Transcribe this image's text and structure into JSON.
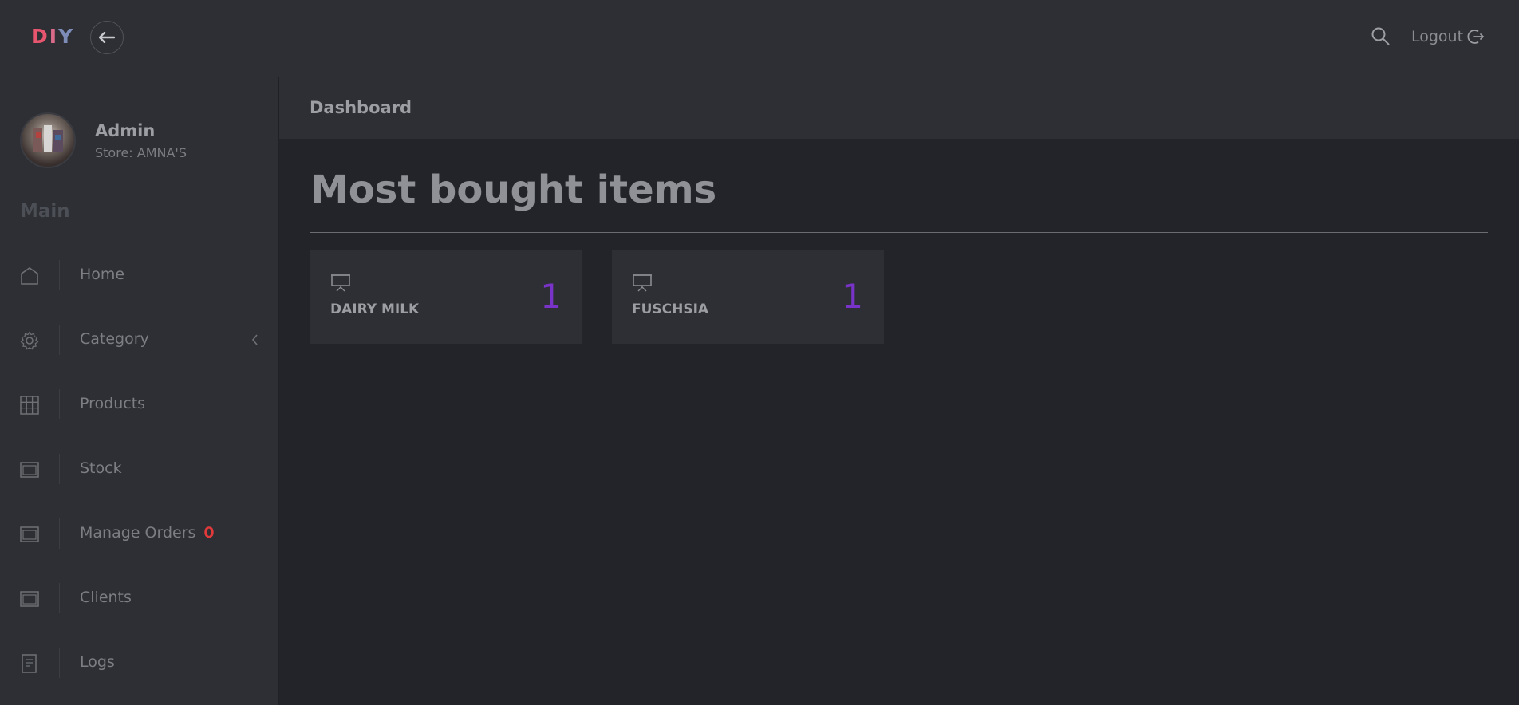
{
  "header": {
    "logo": {
      "l1": "D",
      "l2": "I",
      "l3": "Y"
    },
    "back_icon": "arrow-left-icon",
    "search_icon": "search-icon",
    "logout_label": "Logout",
    "logout_icon": "logout-icon",
    "colors": {
      "logo_d": "#e8556e",
      "logo_i": "#d96a8a",
      "logo_y": "#7e8cb8"
    }
  },
  "sidebar": {
    "user": {
      "name": "Admin",
      "store": "Store: AMNA'S"
    },
    "section_title": "Main",
    "items": [
      {
        "label": "Home",
        "icon": "home-icon"
      },
      {
        "label": "Category",
        "icon": "gear-icon",
        "chevron": "chevron-left-icon"
      },
      {
        "label": "Products",
        "icon": "grid-icon"
      },
      {
        "label": "Stock",
        "icon": "window-icon"
      },
      {
        "label": "Manage Orders",
        "icon": "window-icon",
        "badge": "0"
      },
      {
        "label": "Clients",
        "icon": "window-icon"
      },
      {
        "label": "Logs",
        "icon": "document-icon"
      }
    ]
  },
  "main": {
    "breadcrumb": "Dashboard",
    "title": "Most bought items",
    "cards": [
      {
        "label": "DAIRY MILK",
        "count": "1",
        "icon": "presentation-icon"
      },
      {
        "label": "FUSCHSIA",
        "count": "1",
        "icon": "presentation-icon"
      }
    ],
    "colors": {
      "count": "#7a33c9",
      "badge": "#e23a3a"
    }
  }
}
